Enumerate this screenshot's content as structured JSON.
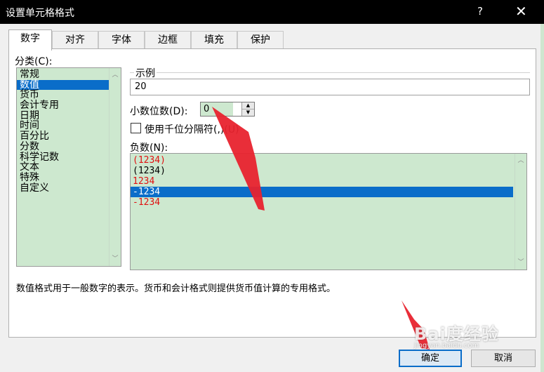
{
  "window": {
    "title": "设置单元格格式",
    "help": "?",
    "close": "✕"
  },
  "tabs": [
    {
      "label": "数字"
    },
    {
      "label": "对齐"
    },
    {
      "label": "字体"
    },
    {
      "label": "边框"
    },
    {
      "label": "填充"
    },
    {
      "label": "保护"
    }
  ],
  "category": {
    "label": "分类(C):",
    "items": [
      "常规",
      "数值",
      "货币",
      "会计专用",
      "日期",
      "时间",
      "百分比",
      "分数",
      "科学记数",
      "文本",
      "特殊",
      "自定义"
    ],
    "selected_index": 1
  },
  "sample": {
    "label": "示例",
    "value": "20"
  },
  "decimals": {
    "label": "小数位数(D):",
    "value": "0"
  },
  "thousands": {
    "label": "使用千位分隔符(,)(U)"
  },
  "negative": {
    "label": "负数(N):",
    "items": [
      "(1234)",
      "(1234)",
      "1234",
      "-1234",
      "-1234"
    ],
    "selected_index": 3
  },
  "description": "数值格式用于一般数字的表示。货币和会计格式则提供货币值计算的专用格式。",
  "buttons": {
    "ok": "确定",
    "cancel": "取消"
  },
  "watermark": {
    "brand": "Bai度经验",
    "url": "jingyan.baidu.com"
  },
  "colors": {
    "list_bg": "#cde8cf",
    "selection": "#0a6dc9",
    "red_negative": "#e01010",
    "annotation_arrow": "#e8232e"
  }
}
